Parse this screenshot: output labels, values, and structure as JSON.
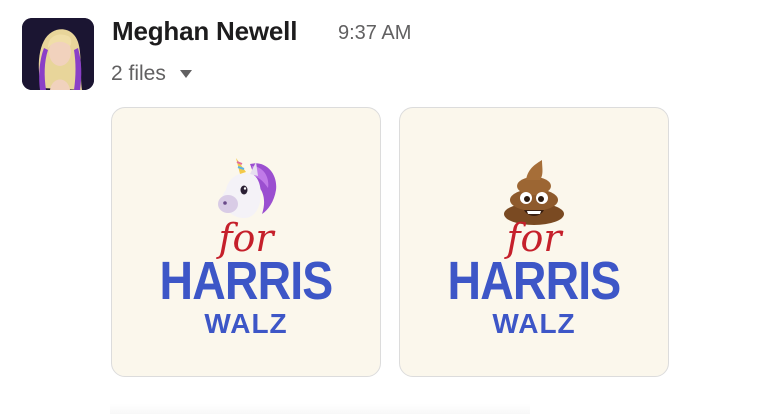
{
  "message": {
    "sender": "Meghan Newell",
    "time": "9:37 AM",
    "files_label": "2 files"
  },
  "attachments": [
    {
      "emoji": "unicorn-icon",
      "line1": "for",
      "line2": "HARRIS",
      "line3": "WALZ"
    },
    {
      "emoji": "poop-icon",
      "line1": "for",
      "line2": "HARRIS",
      "line3": "WALZ"
    }
  ],
  "colors": {
    "card_bg": "#fbf7ec",
    "for_red": "#c5202b",
    "harris_blue": "#3d56c7"
  }
}
